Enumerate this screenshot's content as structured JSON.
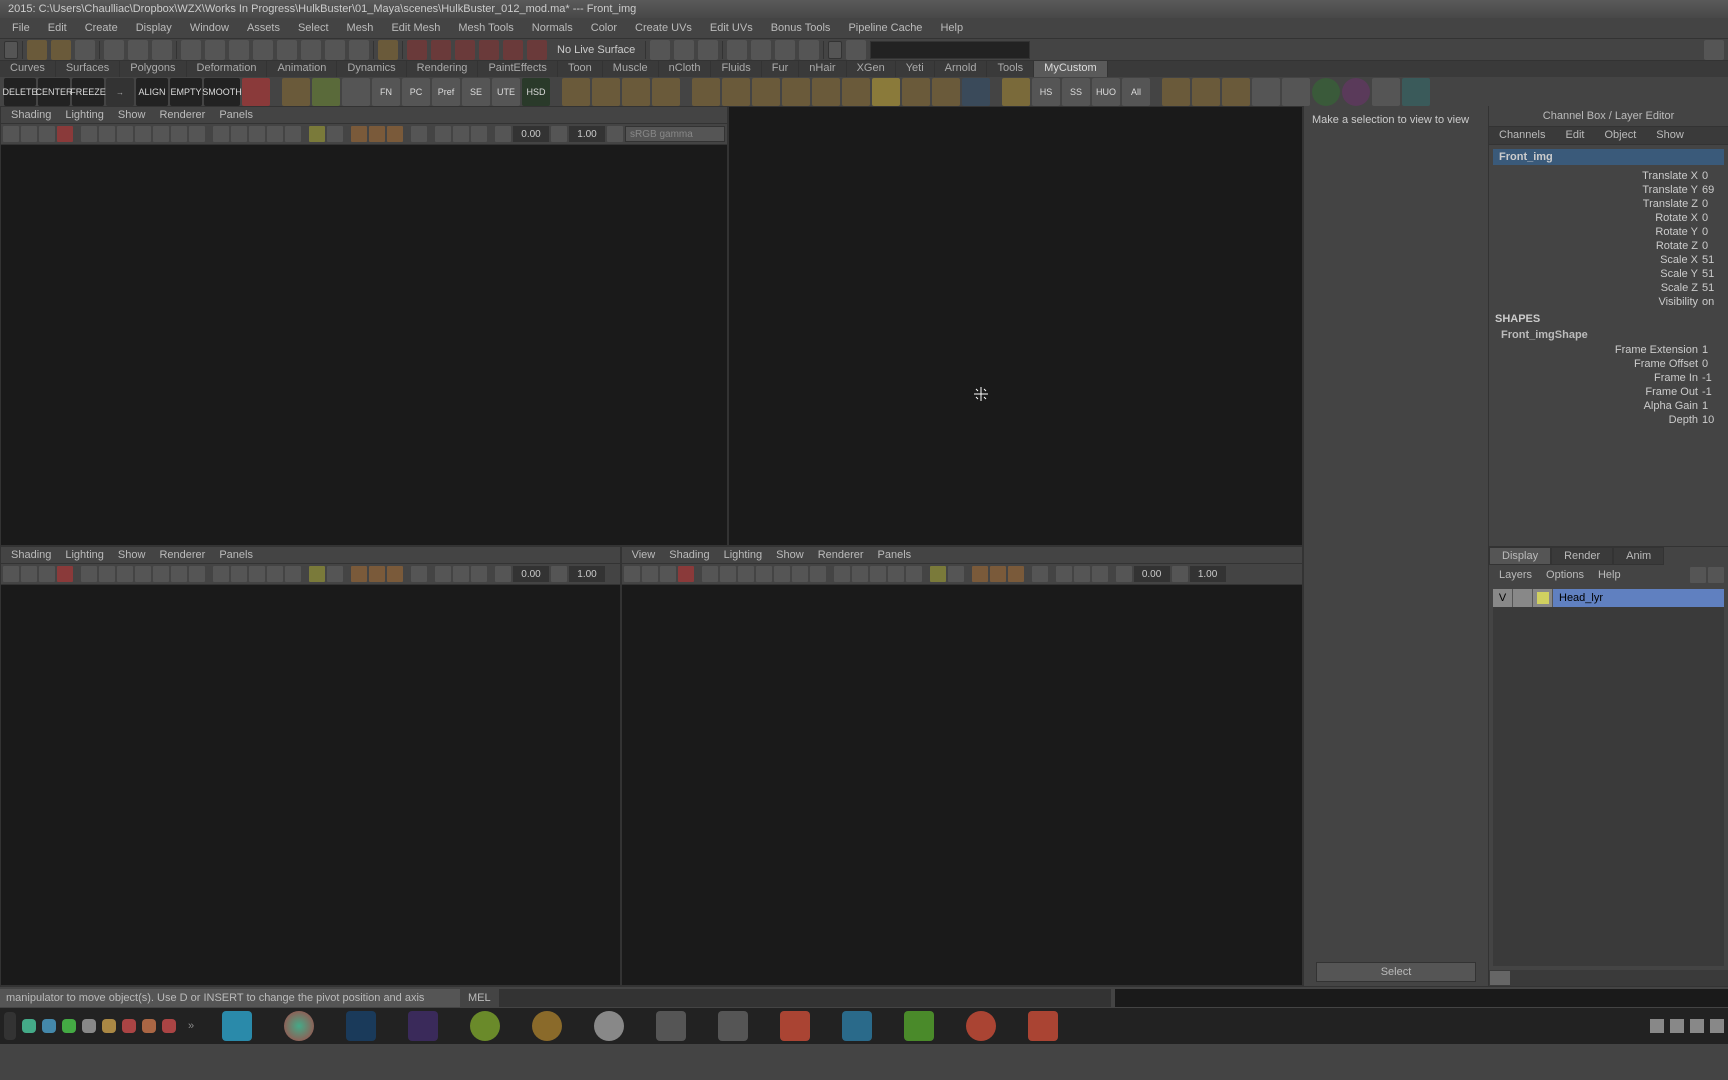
{
  "title": "2015: C:\\Users\\Chaulliac\\Dropbox\\WZX\\Works In Progress\\HulkBuster\\01_Maya\\scenes\\HulkBuster_012_mod.ma*  ---  Front_img",
  "menubar": [
    "File",
    "Edit",
    "Create",
    "Display",
    "Window",
    "Assets",
    "Select",
    "Mesh",
    "Edit Mesh",
    "Mesh Tools",
    "Normals",
    "Color",
    "Create UVs",
    "Edit UVs",
    "Bonus Tools",
    "Pipeline Cache",
    "Help"
  ],
  "statusline": {
    "nolive": "No Live Surface"
  },
  "shelf_tabs": [
    "Curves",
    "Surfaces",
    "Polygons",
    "Deformation",
    "Animation",
    "Dynamics",
    "Rendering",
    "PaintEffects",
    "Toon",
    "Muscle",
    "nCloth",
    "Fluids",
    "Fur",
    "nHair",
    "XGen",
    "Yeti",
    "Arnold",
    "Tools",
    "MyCustom"
  ],
  "shelf_active": "MyCustom",
  "shelf_text_buttons": [
    "FN",
    "PC",
    "Pref",
    "SE",
    "UTE",
    "HSD"
  ],
  "extras_text": [
    ",",
    "DELETE",
    "CENTER",
    "FREEZE",
    "",
    "ALIGN",
    "EMPTY",
    "SMOOTH"
  ],
  "viewport_menu": [
    "View",
    "Shading",
    "Lighting",
    "Show",
    "Renderer",
    "Panels"
  ],
  "viewport_menu_short": [
    "Shading",
    "Lighting",
    "Show",
    "Renderer",
    "Panels"
  ],
  "vp_num1": "0.00",
  "vp_num2": "1.00",
  "gamma": "sRGB gamma",
  "attr_hint": "Make a selection to view to view",
  "attr_select_btn": "Select",
  "right_title": "Channel Box / Layer Editor",
  "right_tabs": [
    "Channels",
    "Edit",
    "Object",
    "Show"
  ],
  "obj_name": "Front_img",
  "channels": [
    {
      "l": "Translate X",
      "v": "0"
    },
    {
      "l": "Translate Y",
      "v": "69"
    },
    {
      "l": "Translate Z",
      "v": "0"
    },
    {
      "l": "Rotate X",
      "v": "0"
    },
    {
      "l": "Rotate Y",
      "v": "0"
    },
    {
      "l": "Rotate Z",
      "v": "0"
    },
    {
      "l": "Scale X",
      "v": "51"
    },
    {
      "l": "Scale Y",
      "v": "51"
    },
    {
      "l": "Scale Z",
      "v": "51"
    },
    {
      "l": "Visibility",
      "v": "on"
    }
  ],
  "shapes_hdr": "SHAPES",
  "shape_name": "Front_imgShape",
  "shape_attrs": [
    {
      "l": "Frame Extension",
      "v": "1"
    },
    {
      "l": "Frame Offset",
      "v": "0"
    },
    {
      "l": "Frame In",
      "v": "-1"
    },
    {
      "l": "Frame Out",
      "v": "-1"
    },
    {
      "l": "Alpha Gain",
      "v": "1"
    },
    {
      "l": "Depth",
      "v": "10"
    }
  ],
  "layer_tabs": [
    "Display",
    "Render",
    "Anim"
  ],
  "layer_menu": [
    "Layers",
    "Options",
    "Help"
  ],
  "layer_item": {
    "vis": "V",
    "name": "Head_lyr"
  },
  "helpline": "manipulator to move object(s). Use D or INSERT to change the pivot position and axis orientation",
  "mel": "MEL",
  "right_shelf_text": [
    "HS",
    "SS",
    "HUO",
    "All"
  ]
}
